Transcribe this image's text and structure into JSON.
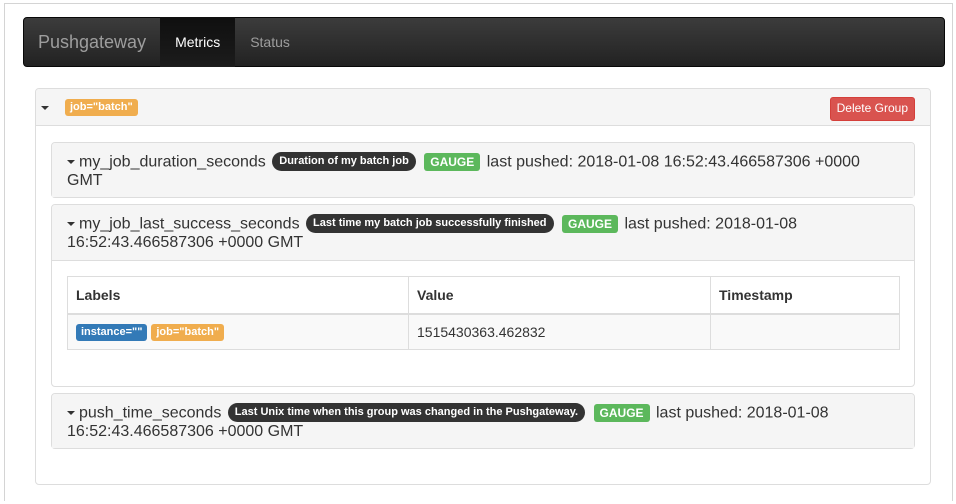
{
  "navbar": {
    "brand": "Pushgateway",
    "items": [
      {
        "label": "Metrics",
        "active": true
      },
      {
        "label": "Status",
        "active": false
      }
    ]
  },
  "group": {
    "label": "job=\"batch\"",
    "delete_button": "Delete Group",
    "metrics": [
      {
        "name": "my_job_duration_seconds",
        "help": "Duration of my batch job",
        "type": "GAUGE",
        "pushed_line1": "last pushed: 2018-01-08 16:52:43.466587306 +0000",
        "pushed_line2": "GMT"
      },
      {
        "name": "my_job_last_success_seconds",
        "help": "Last time my batch job successfully finished",
        "type": "GAUGE",
        "pushed_line1": "last pushed: 2018-01-08",
        "pushed_line2": "16:52:43.466587306 +0000 GMT",
        "table": {
          "headers": [
            "Labels",
            "Value",
            "Timestamp"
          ],
          "rows": [
            {
              "labels": [
                "instance=\"\"",
                "job=\"batch\""
              ],
              "value": "1515430363.462832",
              "timestamp": ""
            }
          ]
        }
      },
      {
        "name": "push_time_seconds",
        "help": "Last Unix time when this group was changed in the Pushgateway.",
        "type": "GAUGE",
        "pushed_line1": "last pushed: 2018-01-08",
        "pushed_line2": "16:52:43.466587306 +0000 GMT"
      }
    ]
  },
  "colors": {
    "navbar": "#222222",
    "label_warning": "#f0ad4e",
    "label_primary": "#337ab7",
    "label_success": "#5cb85c",
    "danger": "#d9534f"
  }
}
